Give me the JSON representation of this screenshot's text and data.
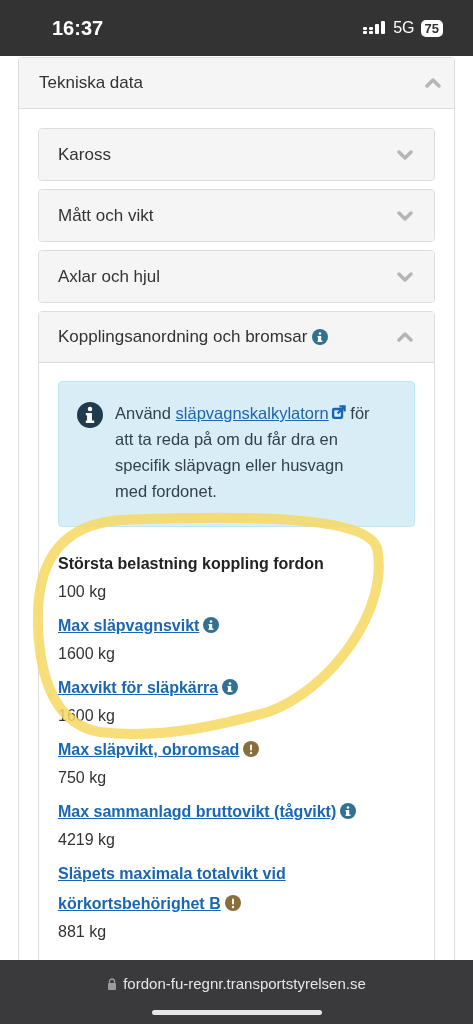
{
  "status_bar": {
    "time": "16:37",
    "network": "5G",
    "battery": "75"
  },
  "panel": {
    "title": "Tekniska data",
    "expanded": true
  },
  "sections": [
    {
      "title": "Kaross",
      "expanded": false,
      "info": false
    },
    {
      "title": "Mått och vikt",
      "expanded": false,
      "info": false
    },
    {
      "title": "Axlar och hjul",
      "expanded": false,
      "info": false
    },
    {
      "title": "Kopplingsanordning och bromsar",
      "expanded": true,
      "info": true
    }
  ],
  "notice": {
    "before": "Använd",
    "link": "släpvagnskalkylatorn",
    "after": "för att ta reda på om du får dra en specifik släpvagn eller husvagn med fordonet."
  },
  "fields": [
    {
      "label": "Största belastning koppling fordon",
      "value": "100 kg",
      "link": false,
      "kind": "plain"
    },
    {
      "label": "Max släpvagnsvikt",
      "value": "1600 kg",
      "link": true,
      "kind": "info"
    },
    {
      "label": "Maxvikt för släpkärra",
      "value": "1600 kg",
      "link": true,
      "kind": "info"
    },
    {
      "label": "Max släpvikt, obromsad",
      "value": "750 kg",
      "link": true,
      "kind": "warning"
    },
    {
      "label": "Max sammanlagd bruttovikt (tågvikt)",
      "value": "4219 kg",
      "link": true,
      "kind": "info"
    },
    {
      "label": "Släpets maximala totalvikt vid körkortsbehörighet B",
      "value": "881 kg",
      "link": true,
      "kind": "warning"
    }
  ],
  "annotation": {
    "kind": "circled"
  },
  "url_bar": {
    "url": "fordon-fu-regnr.transportstyrelsen.se"
  }
}
